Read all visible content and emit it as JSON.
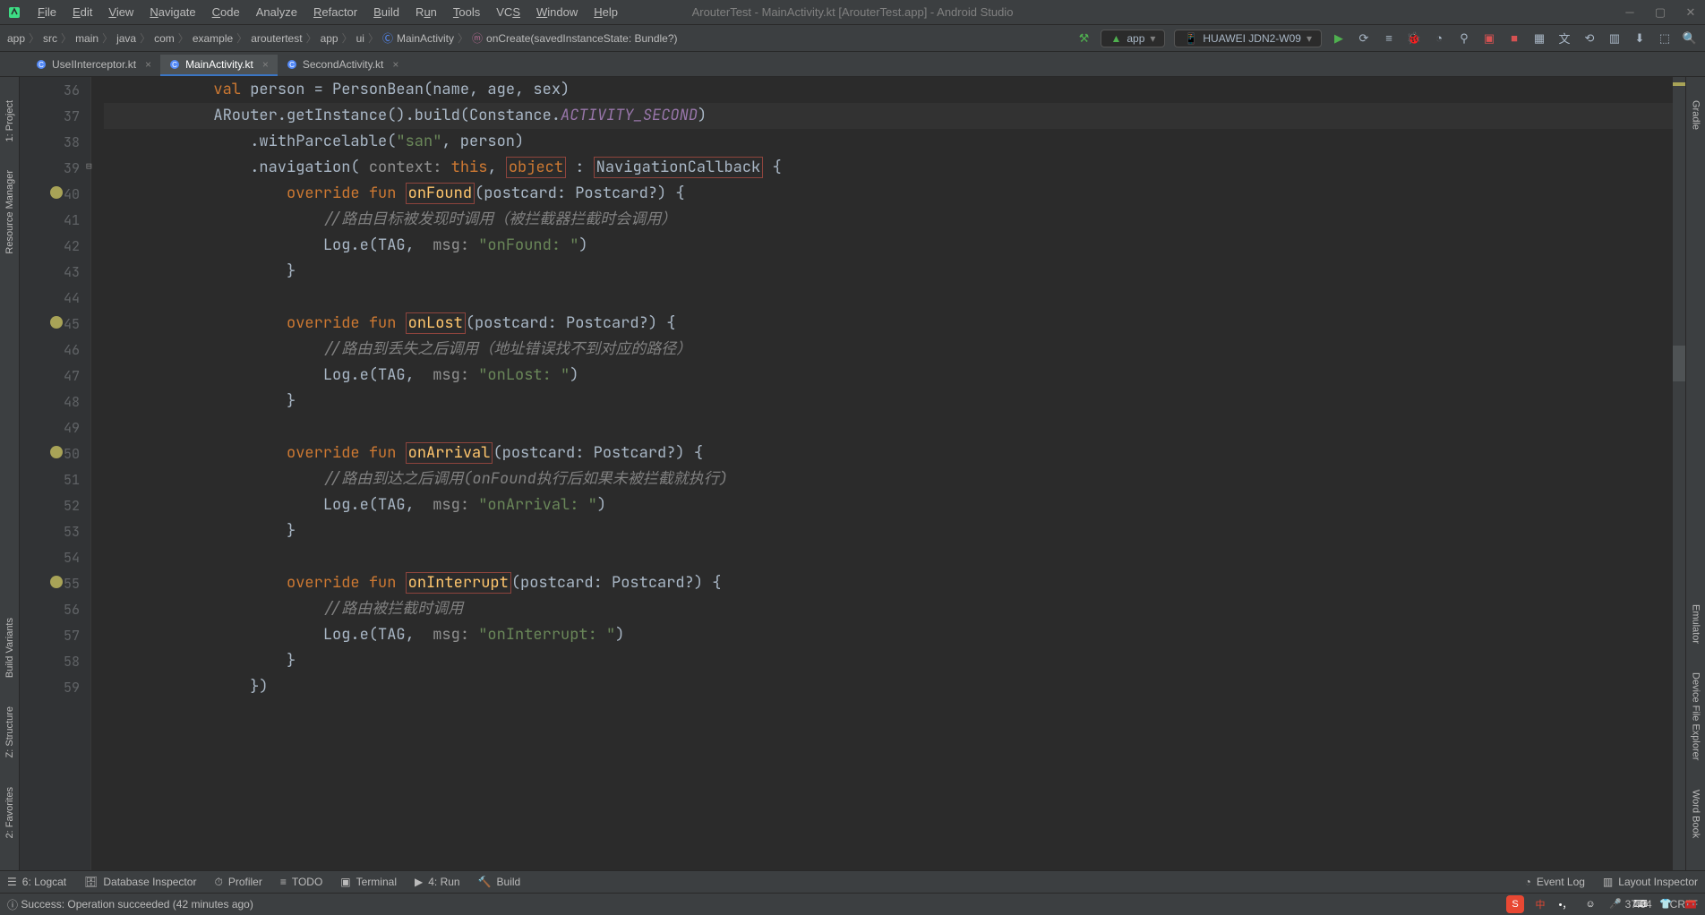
{
  "title": "ArouterTest - MainActivity.kt [ArouterTest.app] - Android Studio",
  "menu": {
    "file": "File",
    "edit": "Edit",
    "view": "View",
    "navigate": "Navigate",
    "code": "Code",
    "analyze": "Analyze",
    "refactor": "Refactor",
    "build": "Build",
    "run": "Run",
    "tools": "Tools",
    "vcs": "VCS",
    "window": "Window",
    "help": "Help"
  },
  "breadcrumb": {
    "items": [
      "app",
      "src",
      "main",
      "java",
      "com",
      "example",
      "aroutertest",
      "app",
      "ui",
      "MainActivity",
      "onCreate(savedInstanceState: Bundle?)"
    ]
  },
  "run_config": {
    "label": "app"
  },
  "device": {
    "label": "HUAWEI JDN2-W09"
  },
  "tabs": {
    "items": [
      {
        "name": "UseIInterceptor.kt",
        "active": false
      },
      {
        "name": "MainActivity.kt",
        "active": true
      },
      {
        "name": "SecondActivity.kt",
        "active": false
      }
    ]
  },
  "left_tools": {
    "project": "1: Project",
    "resource": "Resource Manager",
    "build": "Build Variants",
    "structure": "Z: Structure",
    "favorites": "2: Favorites"
  },
  "right_tools": {
    "gradle": "Gradle",
    "emulator": "Emulator",
    "device_explorer": "Device File Explorer",
    "word_book": "Word Book"
  },
  "gutter": {
    "start": 36,
    "end": 59
  },
  "code": {
    "l36": {
      "val": "val",
      "person": "person",
      "eq": "=",
      "bean": "PersonBean",
      "args": "(name, age, sex)"
    },
    "l37": {
      "a": "ARouter.getInstance().build(Constance.",
      "b": "ACTIVITY_SECOND",
      "c": ")"
    },
    "l38": {
      "a": ".withParcelable(",
      "s": "\"san\"",
      "b": ", person)"
    },
    "l39": {
      "a": ".navigation( ",
      "ctx": "context: ",
      "this": "this",
      "c": ", ",
      "obj": "object",
      "col": " : ",
      "nc": "NavigationCallback",
      "e": " {"
    },
    "l40": {
      "ov": "override",
      "fun": "fun",
      "name": "onFound",
      "args": "(postcard: Postcard?) {"
    },
    "l41": {
      "c": "//路由目标被发现时调用（被拦截器拦截时会调用）"
    },
    "l42": {
      "a": "Log.e(TAG, ",
      "msg": "msg: ",
      "s": "\"onFound: \"",
      "e": ")"
    },
    "l43": {
      "b": "}"
    },
    "l45": {
      "ov": "override",
      "fun": "fun",
      "name": "onLost",
      "args": "(postcard: Postcard?) {"
    },
    "l46": {
      "c": "//路由到丢失之后调用（地址错误找不到对应的路径）"
    },
    "l47": {
      "a": "Log.e(TAG, ",
      "msg": "msg: ",
      "s": "\"onLost: \"",
      "e": ")"
    },
    "l48": {
      "b": "}"
    },
    "l50": {
      "ov": "override",
      "fun": "fun",
      "name": "onArrival",
      "args": "(postcard: Postcard?) {"
    },
    "l51": {
      "c": "//路由到达之后调用(onFound执行后如果未被拦截就执行)"
    },
    "l52": {
      "a": "Log.e(TAG, ",
      "msg": "msg: ",
      "s": "\"onArrival: \"",
      "e": ")"
    },
    "l53": {
      "b": "}"
    },
    "l55": {
      "ov": "override",
      "fun": "fun",
      "name": "onInterrupt",
      "args": "(postcard: Postcard?) {"
    },
    "l56": {
      "c": "//路由被拦截时调用"
    },
    "l57": {
      "a": "Log.e(TAG, ",
      "msg": "msg: ",
      "s": "\"onInterrupt: \"",
      "e": ")"
    },
    "l58": {
      "b": "}"
    },
    "l59": {
      "b": "})"
    }
  },
  "bottom_tabs": {
    "logcat": "6: Logcat",
    "db": "Database Inspector",
    "profiler": "Profiler",
    "todo": "TODO",
    "terminal": "Terminal",
    "run": "4: Run",
    "build": "Build",
    "event": "Event Log",
    "layout": "Layout Inspector"
  },
  "status": {
    "msg": "Success: Operation succeeded (42 minutes ago)",
    "cursor": "37:64",
    "encoding": "CRLF"
  }
}
